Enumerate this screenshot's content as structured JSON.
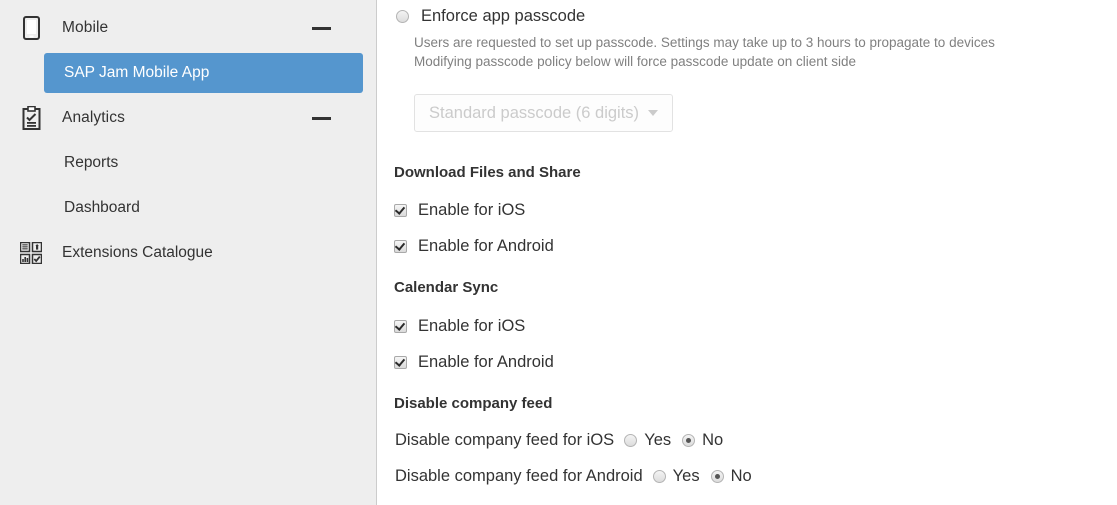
{
  "sidebar": {
    "groups": [
      {
        "label": "Mobile",
        "icon": "mobile-phone-icon",
        "collapse_label": "−",
        "children": [
          {
            "label": "SAP Jam Mobile App",
            "selected": true
          }
        ]
      },
      {
        "label": "Analytics",
        "icon": "clipboard-check-icon",
        "collapse_label": "−",
        "children": [
          {
            "label": "Reports",
            "selected": false
          },
          {
            "label": "Dashboard",
            "selected": false
          }
        ]
      }
    ],
    "standalone": [
      {
        "label": "Extensions Catalogue",
        "icon": "extensions-grid-icon"
      }
    ],
    "colors": {
      "background": "#eeeeee",
      "selected_background": "#5596ce",
      "selected_text": "#ffffff",
      "border": "#cccccc",
      "text": "#333333"
    }
  },
  "main": {
    "passcode": {
      "label": "Enforce app passcode",
      "checked": false,
      "description_line_1": "Users are requested to set up passcode. Settings may take up to 3 hours to propagate to devices",
      "description_line_2": "Modifying passcode policy below will force passcode update on client side",
      "dropdown": {
        "value": "Standard passcode (6 digits)",
        "disabled": true,
        "caret": "caret-down-icon"
      }
    },
    "sections": [
      {
        "heading": "Download Files and Share",
        "checkboxes": [
          {
            "label": "Enable for iOS",
            "checked": true
          },
          {
            "label": "Enable for Android",
            "checked": true
          }
        ]
      },
      {
        "heading": "Calendar Sync",
        "checkboxes": [
          {
            "label": "Enable for iOS",
            "checked": true
          },
          {
            "label": "Enable for Android",
            "checked": true
          }
        ]
      }
    ],
    "disable_feed": {
      "heading": "Disable company feed",
      "rows": [
        {
          "prompt": "Disable company feed for iOS",
          "yes_label": "Yes",
          "no_label": "No",
          "selected": "No"
        },
        {
          "prompt": "Disable company feed for Android",
          "yes_label": "Yes",
          "no_label": "No",
          "selected": "No"
        }
      ]
    }
  }
}
